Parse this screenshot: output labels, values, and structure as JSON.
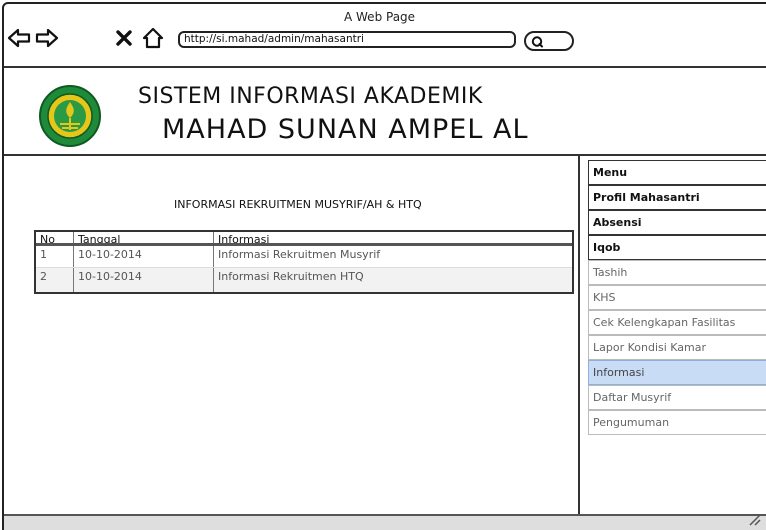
{
  "window": {
    "title": "A Web Page",
    "url": "http://si.mahad/admin/mahasantri"
  },
  "icons": {
    "back": "back-arrow-icon",
    "forward": "forward-arrow-icon",
    "close": "close-icon",
    "home": "home-icon",
    "search": "search-icon",
    "logo": "logo-icon",
    "resize": "resize-grip-icon"
  },
  "header": {
    "title": "SISTEM INFORMASI AKADEMIK",
    "subtitle": "MAHAD SUNAN AMPEL AL"
  },
  "main": {
    "section_title": "INFORMASI REKRUITMEN MUSYRIF/AH & HTQ",
    "table": {
      "columns": [
        "No",
        "Tanggal",
        "Informasi"
      ],
      "rows": [
        [
          "1",
          "10-10-2014",
          "Informasi Rekruitmen Musyrif"
        ],
        [
          "2",
          "10-10-2014",
          "Informasi Rekruitmen HTQ"
        ]
      ]
    }
  },
  "menu": {
    "items": [
      {
        "label": "Menu"
      },
      {
        "label": "Profil Mahasantri"
      },
      {
        "label": "Absensi"
      },
      {
        "label": "Iqob"
      },
      {
        "label": "Tashih"
      },
      {
        "label": "KHS"
      },
      {
        "label": "Cek Kelengkapan Fasilitas"
      },
      {
        "label": "Lapor Kondisi Kamar"
      },
      {
        "label": "Informasi"
      },
      {
        "label": "Daftar Musyrif"
      },
      {
        "label": "Pengumuman"
      }
    ],
    "active_item": "Informasi"
  },
  "colors": {
    "active_menu_bg": "#c9dcf6",
    "logo_green": "#1e8a3a",
    "logo_yellow": "#e6c619"
  }
}
